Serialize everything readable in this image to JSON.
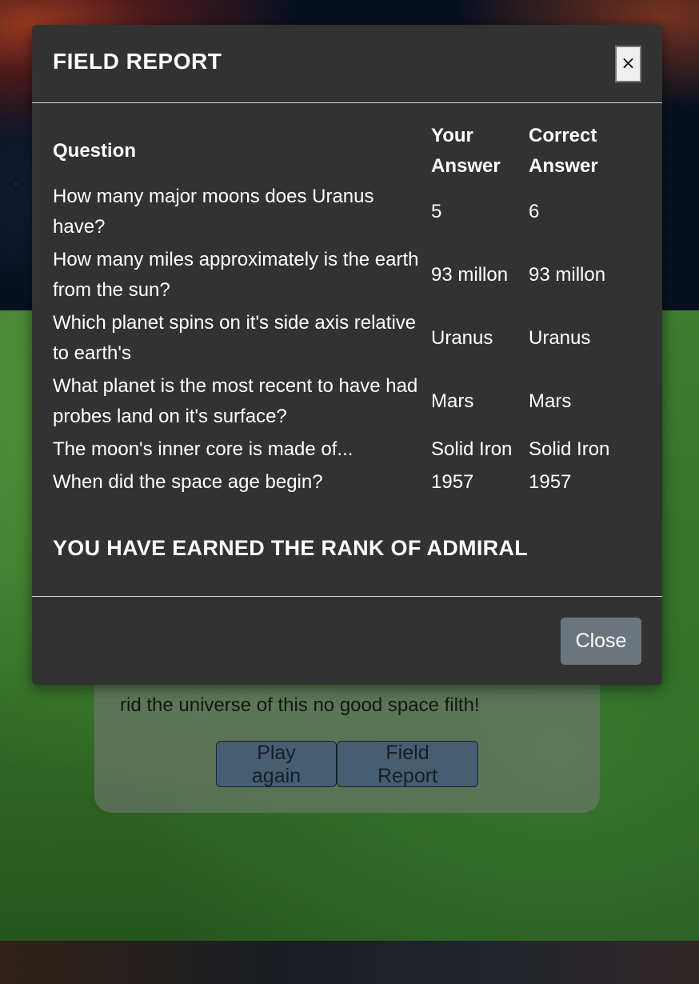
{
  "background": {
    "result_message_line": "rid the universe of this no good space filth!",
    "play_again_label": "Play again",
    "field_report_label": "Field Report"
  },
  "modal": {
    "title": "FIELD REPORT",
    "close_x_label": "×",
    "table": {
      "headers": {
        "question": "Question",
        "your_answer": "Your Answer",
        "correct_answer": "Correct Answer"
      },
      "rows": [
        {
          "question": "How many major moons does Uranus have?",
          "your_answer": "5",
          "correct_answer": "6"
        },
        {
          "question": "How many miles approximately is the earth from the sun?",
          "your_answer": "93 millon",
          "correct_answer": "93 millon"
        },
        {
          "question": "Which planet spins on it's side axis relative to earth's",
          "your_answer": "Uranus",
          "correct_answer": "Uranus"
        },
        {
          "question": "What planet is the most recent to have had probes land on it's surface?",
          "your_answer": "Mars",
          "correct_answer": "Mars"
        },
        {
          "question": "The moon's inner core is made of...",
          "your_answer": "Solid Iron",
          "correct_answer": "Solid Iron"
        },
        {
          "question": "When did the space age begin?",
          "your_answer": "1957",
          "correct_answer": "1957"
        }
      ]
    },
    "rank_message": "YOU HAVE EARNED THE RANK OF ADMIRAL",
    "close_button_label": "Close"
  },
  "colors": {
    "modal_bg": "#333233",
    "close_button_bg": "#6c757d",
    "bg_button": "#55738a"
  }
}
